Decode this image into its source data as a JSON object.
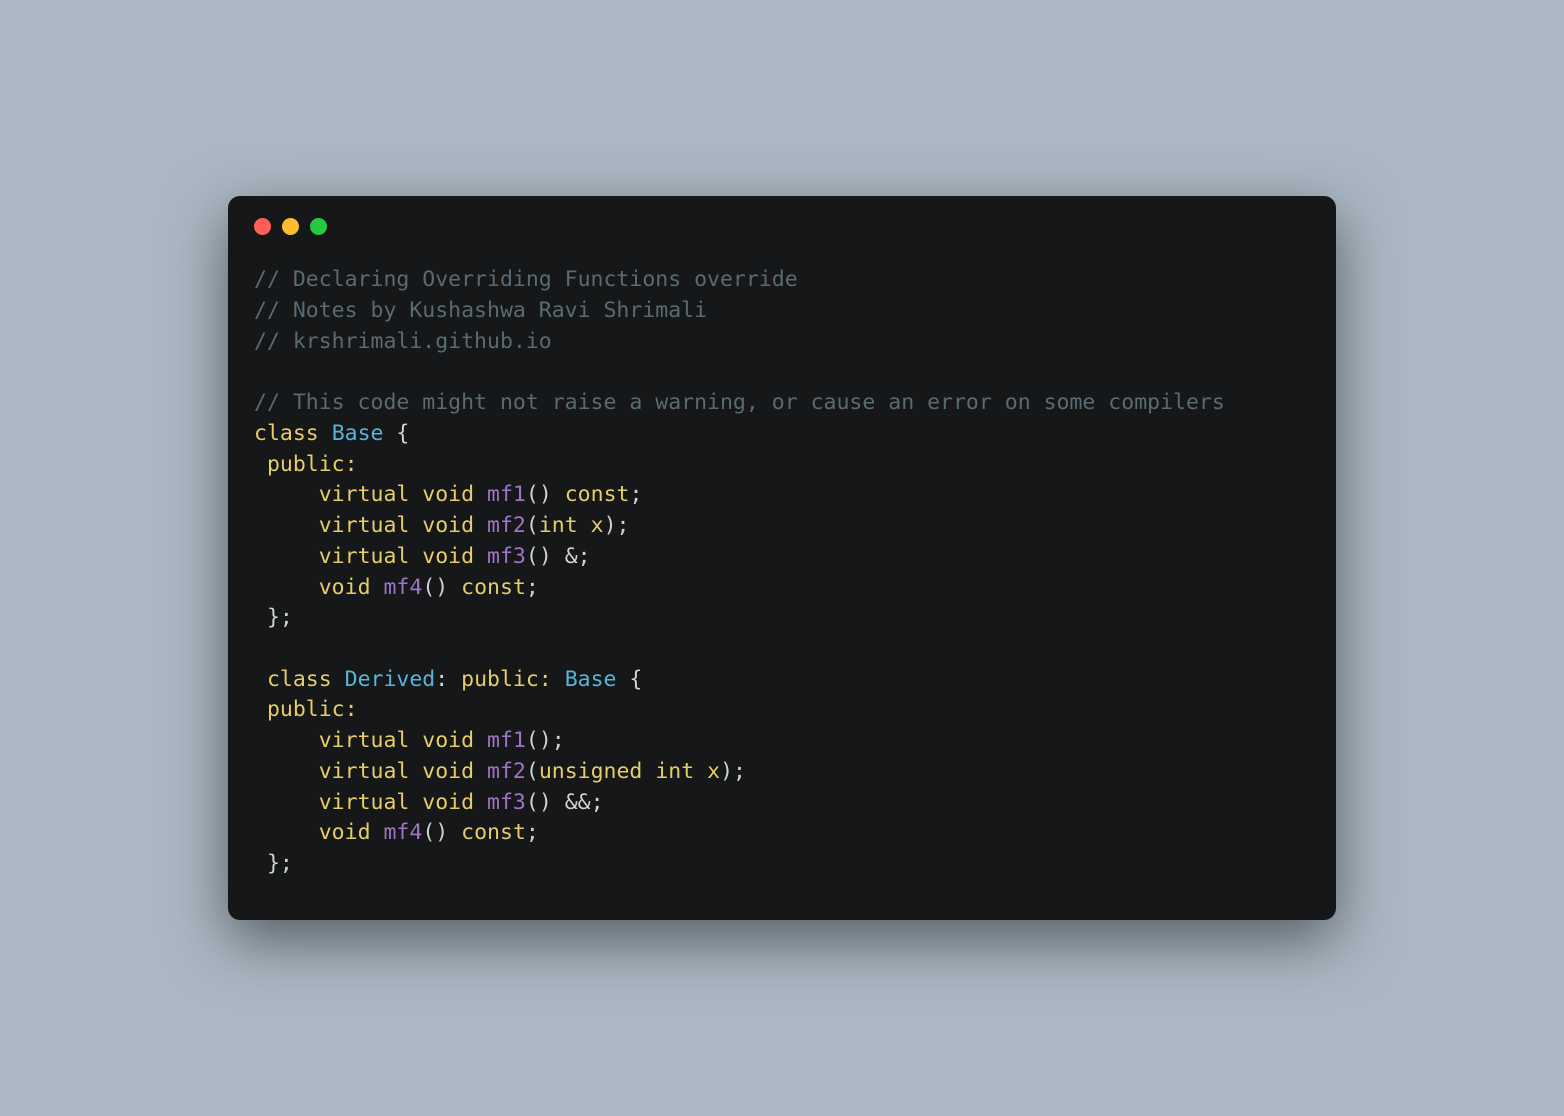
{
  "traffic": {
    "red": "#ff5f56",
    "yellow": "#ffbd2e",
    "green": "#27c93f"
  },
  "c": {
    "l1": "// Declaring Overriding Functions override",
    "l2": "// Notes by Kushashwa Ravi Shrimali",
    "l3": "// krshrimali.github.io",
    "l4": "// This code might not raise a warning, or cause an error on some compilers",
    "kw_class": "class",
    "base": "Base",
    "obrace": " {",
    "public_c": " public:",
    "public": "public:",
    "indent5": "     ",
    "indent1": " ",
    "virtual": "virtual",
    "void": "void",
    "sp": " ",
    "mf1": "mf1",
    "mf2": "mf2",
    "mf3": "mf3",
    "mf4": "mf4",
    "lp": "(",
    "rp": ")",
    "const": "const",
    "semi": ";",
    "int": "int",
    "unsigned": "unsigned",
    "x": "x",
    "amp": " &",
    "ampamp": " &&",
    "cbrace": " };",
    "cbrace2": "};",
    "derived": "Derived",
    "colon_sp": ": ",
    "sp_obrace": " {"
  }
}
